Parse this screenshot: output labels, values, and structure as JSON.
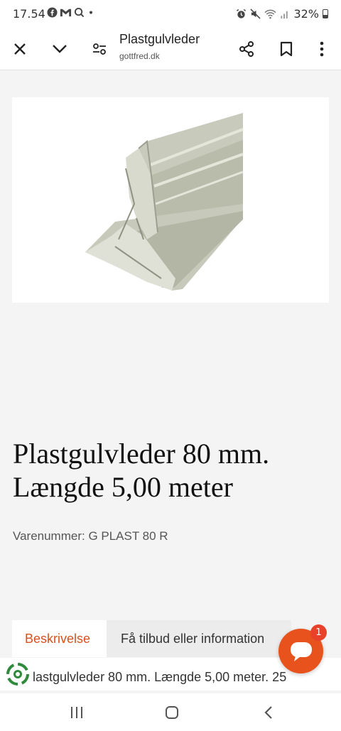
{
  "status_bar": {
    "time": "17.54",
    "left_icons": [
      "facebook-icon",
      "gmail-icon",
      "search-icon",
      "dot-icon"
    ],
    "battery": "32%",
    "right_icons": [
      "alarm-icon",
      "mute-icon",
      "wifi-icon",
      "signal-icon",
      "battery-icon"
    ]
  },
  "browser": {
    "title": "Plastgulvleder",
    "url": "gottfred.dk",
    "icons": [
      "close-icon",
      "chevron-down-icon",
      "settings-icon",
      "share-icon",
      "bookmark-icon",
      "more-icon"
    ]
  },
  "product": {
    "title_line1": "Plastgulvleder 80 mm.",
    "title_line2": "Længde 5,00 meter",
    "sku": "Varenummer: G PLAST 80 R"
  },
  "tabs": [
    {
      "label": "Beskrivelse",
      "active": true
    },
    {
      "label": "Få tilbud eller information",
      "active": false
    }
  ],
  "description": {
    "text": "lastgulvleder 80 mm. Længde 5,00 meter. 25"
  },
  "chat": {
    "badge": "1"
  },
  "colors": {
    "accent": "#e8521d",
    "tab_active_text": "#d9501d",
    "background": "#f4f4f4"
  }
}
